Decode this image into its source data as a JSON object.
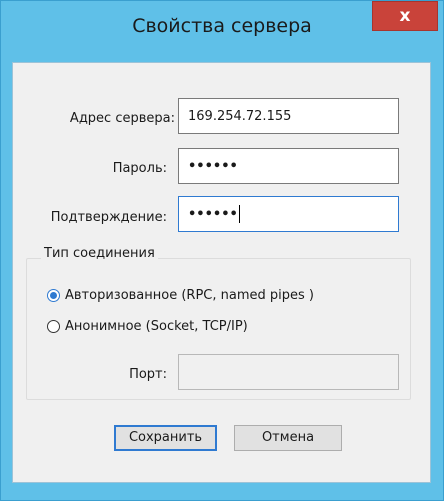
{
  "window": {
    "title": "Свойства сервера",
    "close_label": "x"
  },
  "form": {
    "server_address": {
      "label": "Адрес сервера:",
      "value": "169.254.72.155"
    },
    "password": {
      "label": "Пароль:",
      "value": "••••••"
    },
    "confirm": {
      "label": "Подтверждение:",
      "value": "••••••"
    }
  },
  "connection": {
    "group_label": "Тип соединения",
    "options": [
      {
        "label": "Авторизованное (RPC, named pipes )",
        "selected": true
      },
      {
        "label": "Анонимное (Socket, TCP/IP)",
        "selected": false
      }
    ],
    "port": {
      "label": "Порт:",
      "value": ""
    }
  },
  "buttons": {
    "save_label": "Сохранить",
    "cancel_label": "Отмена"
  },
  "colors": {
    "title_bar": "#5fc0e8",
    "close_button": "#c9433a",
    "focus_accent": "#2f7ad1"
  },
  "icons": {
    "close": "close-icon"
  }
}
